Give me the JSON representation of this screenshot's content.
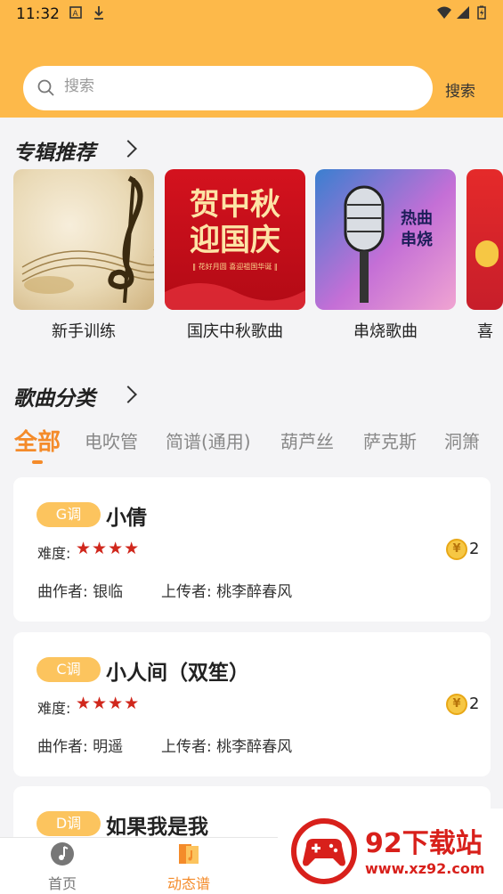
{
  "status": {
    "time": "11:32"
  },
  "search": {
    "placeholder": "搜索",
    "button": "搜索"
  },
  "albums_section": {
    "title": "专辑推荐",
    "items": [
      {
        "label": "新手训练"
      },
      {
        "label": "国庆中秋歌曲",
        "cover_text": [
          "贺中秋",
          "迎国庆"
        ],
        "cover_sub": "‖ 花好月圆 喜迎祖国华诞 ‖"
      },
      {
        "label": "串烧歌曲",
        "cover_text": [
          "热曲",
          "串烧"
        ]
      },
      {
        "label": "喜"
      }
    ]
  },
  "category_section": {
    "title": "歌曲分类",
    "tabs": [
      "全部",
      "电吹管",
      "简谱(通用)",
      "葫芦丝",
      "萨克斯",
      "洞箫"
    ],
    "active_tab": "全部"
  },
  "songs": [
    {
      "key": "G调",
      "title": "小倩",
      "difficulty_label": "难度:",
      "stars": 4,
      "stars_text": "★★★★",
      "coin_symbol": "¥",
      "price": "2",
      "composer": "曲作者: 银临",
      "uploader": "上传者: 桃李醉春风"
    },
    {
      "key": "C调",
      "title": "小人间（双笙）",
      "difficulty_label": "难度:",
      "stars": 4,
      "stars_text": "★★★★",
      "coin_symbol": "¥",
      "price": "2",
      "composer": "曲作者: 明遥",
      "uploader": "上传者: 桃李醉春风"
    },
    {
      "key": "D调",
      "title": "如果我是我"
    }
  ],
  "bottom_nav": [
    {
      "label": "首页",
      "icon": "music-note-icon",
      "active": false
    },
    {
      "label": "动态谱",
      "icon": "sheet-music-icon",
      "active": true
    }
  ],
  "watermark": {
    "title": "92下载站",
    "url": "www.xz92.com"
  },
  "colors": {
    "accent": "#fdb94a",
    "active_tab": "#f48b2a",
    "star": "#d0271c",
    "badge": "#fcc45e"
  }
}
